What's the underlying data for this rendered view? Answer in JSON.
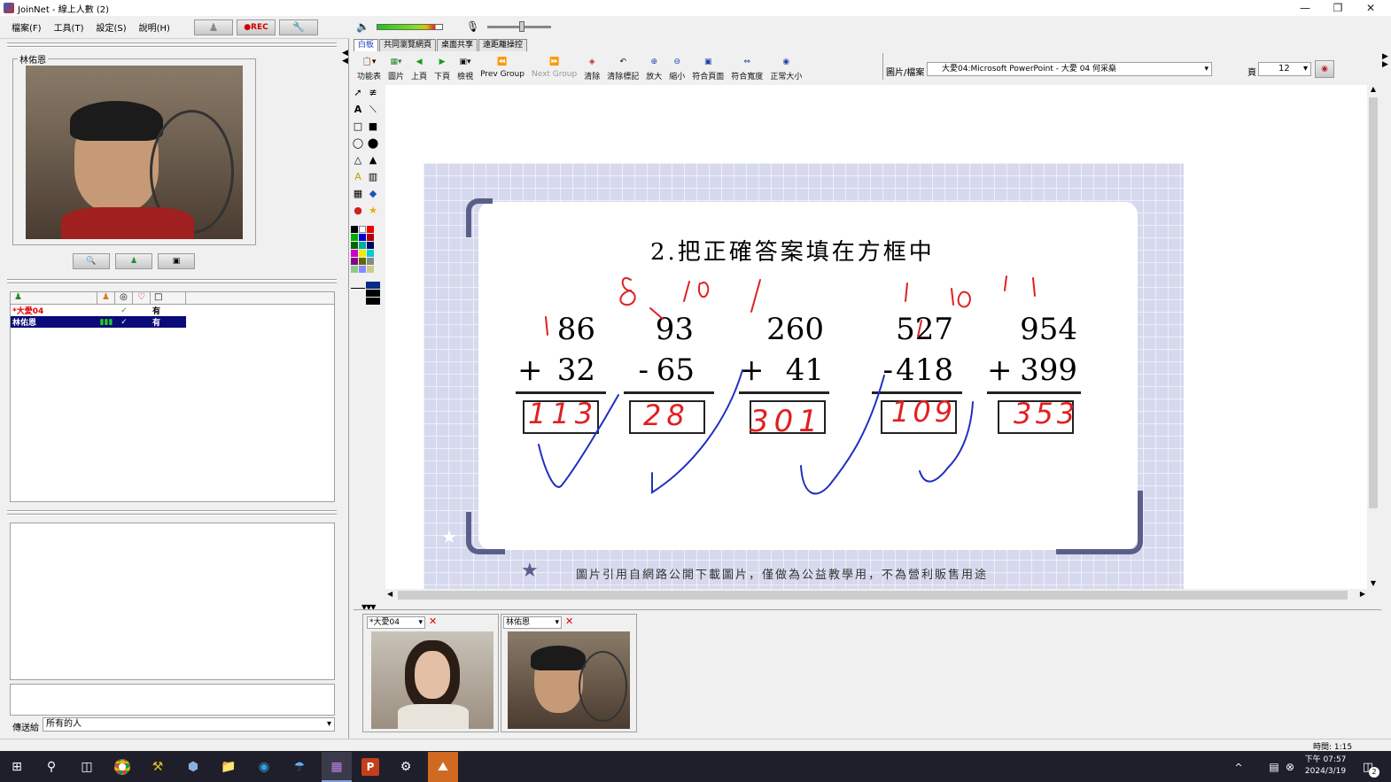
{
  "window": {
    "title": "JoinNet - 線上人數 (2)"
  },
  "menu": [
    "檔案(F)",
    "工具(T)",
    "設定(S)",
    "說明(H)"
  ],
  "rec_label": "REC",
  "local_video": {
    "label": "林佑恩"
  },
  "participants": {
    "rows": [
      {
        "name": "*大愛04",
        "status": "有",
        "highlight": false
      },
      {
        "name": "林佑恩",
        "status": "有",
        "highlight": true
      }
    ]
  },
  "chat": {
    "send_to_label": "傳送給",
    "send_to_value": "所有的人"
  },
  "tabs": [
    "白板",
    "共同瀏覽網頁",
    "桌面共享",
    "遠距離操控"
  ],
  "toolbar": {
    "items": [
      {
        "label": "功能表",
        "icon": "menu-icon",
        "disabled": false
      },
      {
        "label": "圖片",
        "icon": "picture-icon",
        "disabled": false
      },
      {
        "label": "上頁",
        "icon": "prev-page-icon",
        "disabled": false
      },
      {
        "label": "下頁",
        "icon": "next-page-icon",
        "disabled": false
      },
      {
        "label": "檢視",
        "icon": "view-icon",
        "disabled": false
      },
      {
        "label": "Prev Group",
        "icon": "prev-group-icon",
        "disabled": false
      },
      {
        "label": "Next Group",
        "icon": "next-group-icon",
        "disabled": true
      },
      {
        "label": "清除",
        "icon": "clear-icon",
        "disabled": false
      },
      {
        "label": "清除標記",
        "icon": "clear-marks-icon",
        "disabled": false
      },
      {
        "label": "放大",
        "icon": "zoom-in-icon",
        "disabled": false
      },
      {
        "label": "縮小",
        "icon": "zoom-out-icon",
        "disabled": false
      },
      {
        "label": "符合頁面",
        "icon": "fit-page-icon",
        "disabled": false
      },
      {
        "label": "符合寬度",
        "icon": "fit-width-icon",
        "disabled": false
      },
      {
        "label": "正常大小",
        "icon": "normal-size-icon",
        "disabled": false
      }
    ],
    "file_label": "圖片/檔案",
    "file_value": "大愛04:Microsoft PowerPoint - 大愛 04 何采燊",
    "page_label": "頁",
    "page_value": "12"
  },
  "slide": {
    "title": "2.把正確答案填在方框中",
    "problems": [
      {
        "top": "86",
        "op": "+",
        "bottom": "32",
        "answer": "113"
      },
      {
        "top": "93",
        "op": "-",
        "bottom": "65",
        "answer": "28"
      },
      {
        "top": "260",
        "op": "+",
        "bottom": "41",
        "answer": "301"
      },
      {
        "top": "527",
        "op": "-",
        "bottom": "418",
        "answer": "109"
      },
      {
        "top": "954",
        "op": "+",
        "bottom": "399",
        "answer": "353"
      }
    ],
    "footer": "圖片引用自網路公開下載圖片，僅做為公益教學用，不為營利販售用途"
  },
  "video_tiles": [
    {
      "name": "*大愛04"
    },
    {
      "name": "林佑恩"
    }
  ],
  "status": {
    "time": "時間: 1:15"
  },
  "taskbar": {
    "time": "下午 07:57",
    "date": "2024/3/19",
    "notifications": "2"
  },
  "colors": {
    "ink_red": "#e02020",
    "ink_blue": "#2030c0",
    "slide_bg": "#d6d9ee",
    "taskbar": "#1f1f2b"
  }
}
